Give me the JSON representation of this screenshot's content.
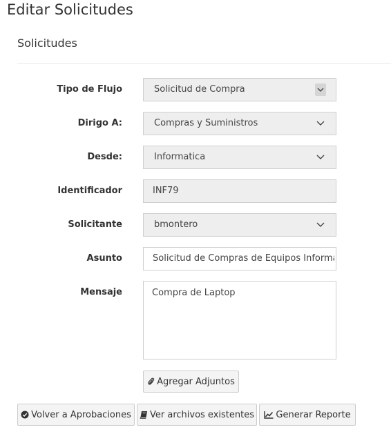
{
  "page": {
    "title": "Editar Solicitudes"
  },
  "panel": {
    "title": "Solicitudes"
  },
  "form": {
    "tipo_flujo": {
      "label": "Tipo de Flujo",
      "value": "Solicitud de Compra"
    },
    "dirigo_a": {
      "label": "Dirigo A:",
      "value": "Compras y Suministros"
    },
    "desde": {
      "label": "Desde:",
      "value": "Informatica"
    },
    "identificador": {
      "label": "Identificador",
      "value": "INF79"
    },
    "solicitante": {
      "label": "Solicitante",
      "value": "bmontero"
    },
    "asunto": {
      "label": "Asunto",
      "value": "Solicitud de Compras de Equipos Informatic"
    },
    "mensaje": {
      "label": "Mensaje",
      "value": "Compra de Laptop"
    }
  },
  "buttons": {
    "agregar_adjuntos": "Agregar Adjuntos",
    "volver": "Volver a Aprobaciones",
    "ver_archivos": "Ver archivos existentes",
    "generar_reporte": "Generar Reporte"
  },
  "icons": {
    "paperclip": "paperclip-icon",
    "check_circle": "check-circle-icon",
    "book": "book-icon",
    "line_chart": "line-chart-icon",
    "chevron": "chevron-down-icon"
  }
}
